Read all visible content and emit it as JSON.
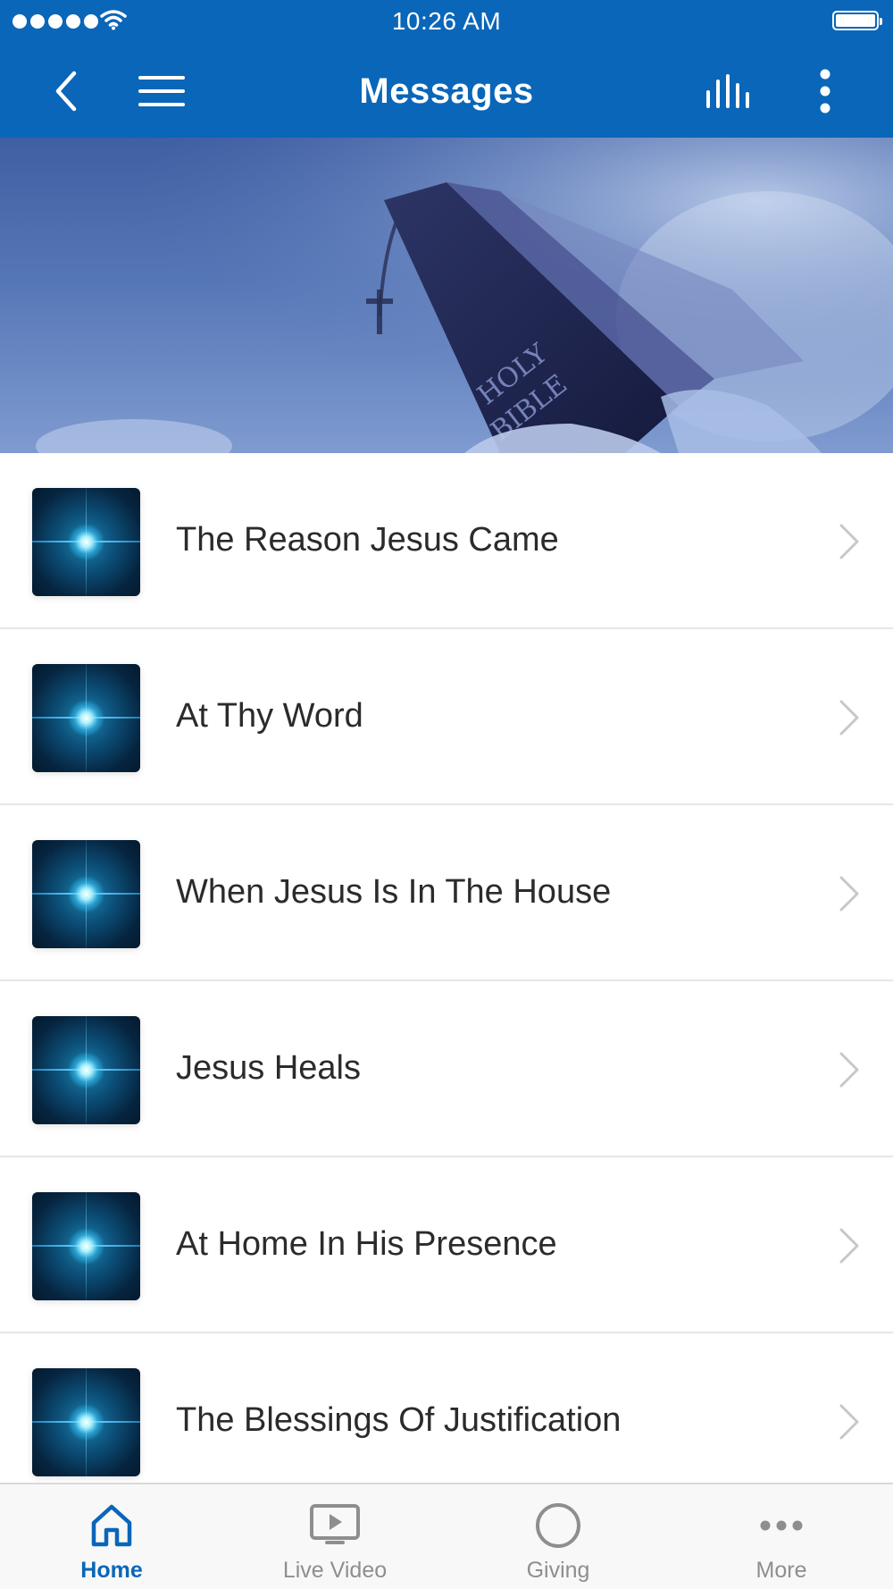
{
  "status_bar": {
    "time": "10:26 AM"
  },
  "nav": {
    "title": "Messages",
    "icons": [
      "back-chevron-icon",
      "hamburger-menu-icon",
      "equalizer-icon",
      "vertical-dots-icon"
    ]
  },
  "hero": {
    "image": "holy-bible-hero",
    "book_text": "HOLY BIBLE"
  },
  "list": {
    "items": [
      {
        "title": "The Reason Jesus Came"
      },
      {
        "title": "At Thy Word"
      },
      {
        "title": "When Jesus Is In The House"
      },
      {
        "title": "Jesus Heals"
      },
      {
        "title": "At Home In His Presence"
      },
      {
        "title": "The Blessings Of Justification"
      }
    ]
  },
  "tab_bar": {
    "tabs": [
      {
        "label": "Home",
        "icon": "home-icon",
        "active": true
      },
      {
        "label": "Live Video",
        "icon": "tv-play-icon",
        "active": false
      },
      {
        "label": "Giving",
        "icon": "circle-icon",
        "active": false
      },
      {
        "label": "More",
        "icon": "more-dots-icon",
        "active": false
      }
    ]
  },
  "colors": {
    "brand": "#0a66b8",
    "tab_inactive": "#8e8e8e",
    "separator": "#e6e6e6"
  }
}
